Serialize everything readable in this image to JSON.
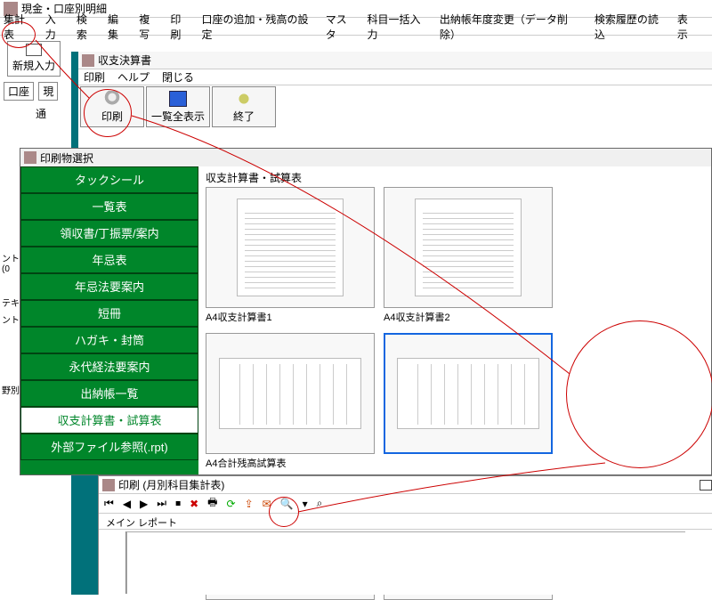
{
  "main_title": "現金・口座別明細",
  "menubar": [
    "集計表",
    "入力",
    "検索",
    "編集",
    "複写",
    "印刷",
    "口座の追加・残高の設定",
    "マスタ",
    "科目一括入力",
    "出納帳年度変更（データ削除）",
    "検索履歴の読込",
    "表示"
  ],
  "new_input": "新規入力",
  "acct_label": "口座",
  "acct_cur": "現",
  "acct_sub": "通",
  "left_frag1": "ント (0",
  "left_frag2": "テキ",
  "left_frag3": "ント",
  "left_frag4": "野別",
  "child1": {
    "title": "収支決算書",
    "menu": [
      "印刷",
      "ヘルプ",
      "閉じる"
    ],
    "btn_print": "印刷",
    "btn_listall": "一覧全表示",
    "btn_exit": "終了"
  },
  "psel": {
    "title": "印刷物選択",
    "cats": [
      "タックシール",
      "一覧表",
      "領収書/丁振票/案内",
      "年忌表",
      "年忌法要案内",
      "短冊",
      "ハガキ・封筒",
      "永代経法要案内",
      "出納帳一覧",
      "収支計算書・試算表",
      "外部ファイル参照(.rpt)"
    ],
    "selected_cat_index": 9,
    "section_title": "収支計算書・試算表",
    "thumbs": [
      "A4収支計算書1",
      "A4収支計算書2",
      "A4合計残高試算表"
    ]
  },
  "pprev": {
    "title": "印刷 (月別科目集計表)",
    "nav": {
      "first": "⏮",
      "prev": "◀",
      "next": "▶",
      "last": "⏭"
    },
    "tool_stop": "⏹",
    "tool_x": "✖",
    "tool_print": "🖶",
    "tool_refresh": "⟳",
    "tool_export": "⇪",
    "tool_mail": "✉",
    "tool_zoom": "🔍",
    "tool_dd": "▾",
    "tool_find": "⌕",
    "tab": "メイン レポート"
  }
}
